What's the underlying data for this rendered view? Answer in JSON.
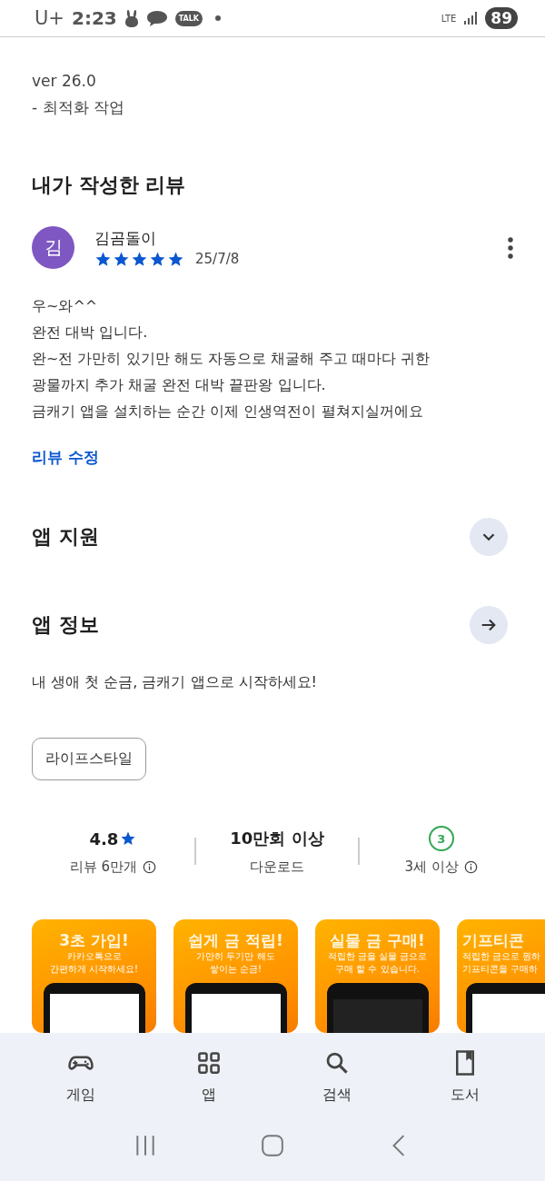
{
  "status_bar": {
    "carrier": "U+",
    "time": "2:23",
    "notification_icons": [
      {
        "kind": "bunny"
      },
      {
        "kind": "chat"
      },
      {
        "kind": "talk",
        "label": "TALK"
      },
      {
        "kind": "dot"
      }
    ],
    "network": "LTE",
    "battery": "89"
  },
  "whats_new": [
    "ver 26.0",
    "- 최적화 작업"
  ],
  "my_review": {
    "heading": "내가 작성한 리뷰",
    "avatar_letter": "김",
    "author": "김곰돌이",
    "stars": 5,
    "date": "25/7/8",
    "body": [
      "우~와^^",
      "완전 대박 입니다.",
      "완~전 가만히 있기만 해도 자동으로 채굴해 주고 때마다 귀한 광물까지 추가 채굴 완전 대박 끝판왕 입니다.",
      "금캐기 앱을 설치하는 순간 이제 인생역전이 펼쳐지실꺼에요"
    ],
    "edit_link": "리뷰 수정"
  },
  "sections": [
    {
      "title": "앱 지원",
      "kind": "expand"
    },
    {
      "title": "앱 정보",
      "kind": "arrow"
    }
  ],
  "app_description": "내 생애 첫 순금, 금캐기 앱으로 시작하세요!",
  "tags": [
    {
      "label": "라이프스타일"
    }
  ],
  "stats": [
    {
      "kind": "rating",
      "value": "4.8",
      "label": "리뷰 6만개",
      "info": true
    },
    {
      "kind": "text",
      "value": "10만회 이상",
      "label": "다운로드",
      "info": false
    },
    {
      "kind": "age",
      "value": "3",
      "label": "3세 이상",
      "info": true
    }
  ],
  "screenshots": [
    {
      "title": "3초 가입!",
      "subtitle": [
        "카카오톡으로",
        "간편하게 시작하세요!"
      ]
    },
    {
      "title": "쉽게 금 적립!",
      "subtitle": [
        "가만히 두기만 해도",
        "쌓이는 순금!"
      ]
    },
    {
      "title": "실물 금 구매!",
      "subtitle": [
        "적립한 금을 실물 금으로",
        "구매 할 수 있습니다."
      ]
    },
    {
      "title": "기프티콘",
      "subtitle": [
        "적립한 금으로 원하",
        "기프티콘을 구매하"
      ]
    }
  ],
  "bottom_nav": [
    {
      "kind": "games",
      "label": "게임"
    },
    {
      "kind": "apps",
      "label": "앱"
    },
    {
      "kind": "search",
      "label": "검색"
    },
    {
      "kind": "books",
      "label": "도서"
    }
  ],
  "system_nav": [
    {
      "kind": "recent"
    },
    {
      "kind": "home"
    },
    {
      "kind": "back"
    }
  ]
}
